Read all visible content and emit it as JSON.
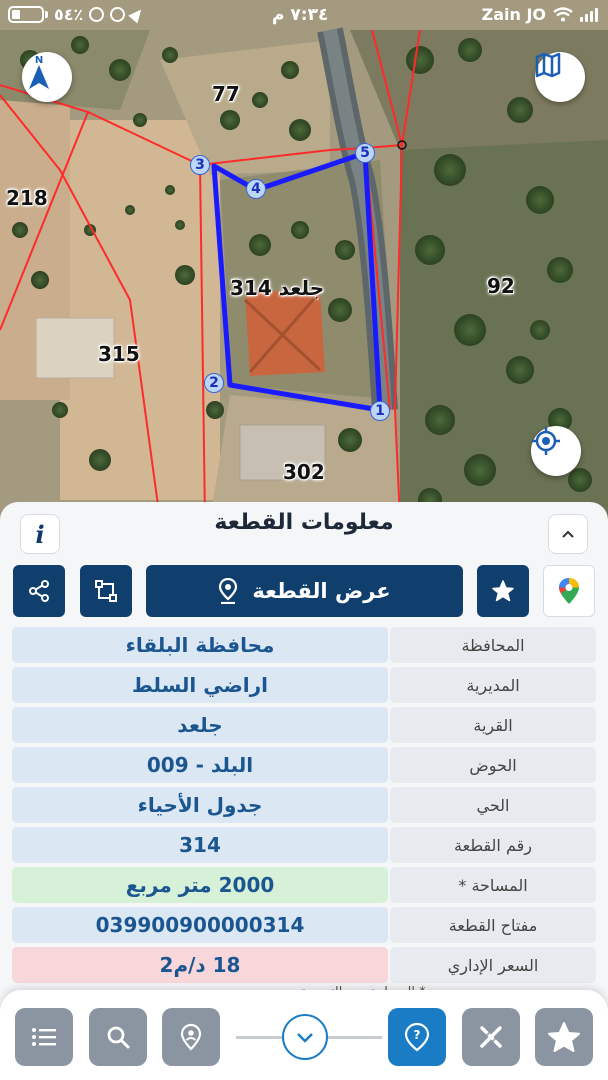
{
  "status_bar": {
    "battery": "٥٤٪",
    "time": "٧:٣٤ م",
    "carrier": "Zain JO"
  },
  "map": {
    "parcel_labels": [
      "77",
      "218",
      "92",
      "315",
      "302",
      "314 جلعد"
    ],
    "vertices": [
      "1",
      "2",
      "3",
      "4",
      "5"
    ],
    "compass_label": "N",
    "boundary_color": "#1a1aff",
    "neighbor_line_color": "#ff2a2a"
  },
  "panel": {
    "title": "معلومات القطعة",
    "info_label": "i",
    "show_parcel_label": "عرض القطعة",
    "fields": [
      {
        "label": "المحافظة",
        "value": "محافظة البلقاء"
      },
      {
        "label": "المديرية",
        "value": "اراضي السلط"
      },
      {
        "label": "القرية",
        "value": "جلعد"
      },
      {
        "label": "الحوض",
        "value": "البلد - 009"
      },
      {
        "label": "الحي",
        "value": "جدول الأحياء"
      },
      {
        "label": "رقم القطعة",
        "value": "314"
      },
      {
        "label": "المساحة *",
        "value": "2000  متر مربع"
      },
      {
        "label": "مفتاح القطعة",
        "value": "039900900000314"
      },
      {
        "label": "السعر الإداري",
        "value": "18 د/م2"
      }
    ],
    "footnote_cutoff": "* المساحة ... والتوسعة"
  },
  "colors": {
    "primary": "#103f6e",
    "accent": "#1a7cc4",
    "value_bg": "#dbe7f3",
    "area_bg": "#d7f1d8",
    "price_bg": "#f7d7da"
  }
}
